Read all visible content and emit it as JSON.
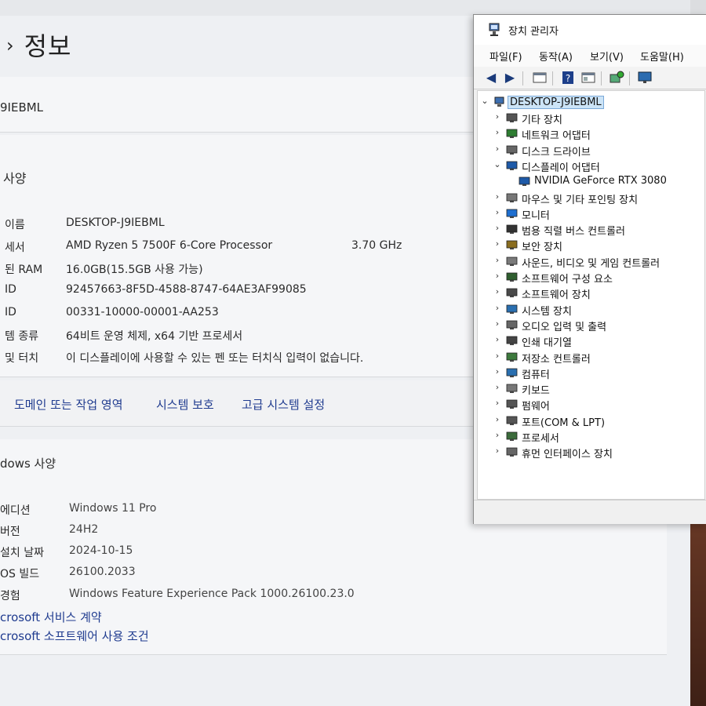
{
  "settings": {
    "breadcrumb_chevron": "›",
    "title": "정보",
    "device_name_partial": "9IEBML",
    "spec_header": "사양",
    "specs": [
      {
        "label": "이름",
        "value": "DESKTOP-J9IEBML",
        "extra": ""
      },
      {
        "label": "세서",
        "value": "AMD Ryzen 5 7500F 6-Core Processor",
        "extra": "3.70 GHz"
      },
      {
        "label": "된 RAM",
        "value": "16.0GB(15.5GB 사용 가능)",
        "extra": ""
      },
      {
        "label": "ID",
        "value": "92457663-8F5D-4588-8747-64AE3AF99085",
        "extra": ""
      },
      {
        "label": "ID",
        "value": "00331-10000-00001-AA253",
        "extra": ""
      },
      {
        "label": "템 종류",
        "value": "64비트 운영 체제, x64 기반 프로세서",
        "extra": ""
      },
      {
        "label": "및 터치",
        "value": "이 디스플레이에 사용할 수 있는 펜 또는 터치식 입력이 없습니다.",
        "extra": ""
      }
    ],
    "links": [
      "도메인 또는 작업 영역",
      "시스템 보호",
      "고급 시스템 설정"
    ],
    "windows_header": "dows 사양",
    "windows_specs": [
      {
        "label": "에디션",
        "value": "Windows 11 Pro"
      },
      {
        "label": "버전",
        "value": "24H2"
      },
      {
        "label": "설치 날짜",
        "value": "2024-10-15"
      },
      {
        "label": "OS 빌드",
        "value": "26100.2033"
      },
      {
        "label": "경험",
        "value": "Windows Feature Experience Pack 1000.26100.23.0"
      }
    ],
    "ms_links": [
      "crosoft 서비스 계약",
      "crosoft 소프트웨어 사용 조건"
    ]
  },
  "device_manager": {
    "title": "장치 관리자",
    "menu": [
      "파일(F)",
      "동작(A)",
      "보기(V)",
      "도움말(H)"
    ],
    "root": "DESKTOP-J9IEBML",
    "tree": [
      {
        "label": "기타 장치",
        "icon": "question-device-icon",
        "expanded": false,
        "level": 1
      },
      {
        "label": "네트워크 어댑터",
        "icon": "network-adapter-icon",
        "expanded": false,
        "level": 1
      },
      {
        "label": "디스크 드라이브",
        "icon": "disk-drive-icon",
        "expanded": false,
        "level": 1
      },
      {
        "label": "디스플레이 어댑터",
        "icon": "display-adapter-icon",
        "expanded": true,
        "level": 1
      },
      {
        "label": "NVIDIA GeForce RTX 3080",
        "icon": "gpu-icon",
        "expanded": null,
        "level": 2
      },
      {
        "label": "마우스 및 기타 포인팅 장치",
        "icon": "mouse-icon",
        "expanded": false,
        "level": 1
      },
      {
        "label": "모니터",
        "icon": "monitor-icon",
        "expanded": false,
        "level": 1
      },
      {
        "label": "범용 직렬 버스 컨트롤러",
        "icon": "usb-icon",
        "expanded": false,
        "level": 1
      },
      {
        "label": "보안 장치",
        "icon": "security-icon",
        "expanded": false,
        "level": 1
      },
      {
        "label": "사운드, 비디오 및 게임 컨트롤러",
        "icon": "sound-icon",
        "expanded": false,
        "level": 1
      },
      {
        "label": "소프트웨어 구성 요소",
        "icon": "software-component-icon",
        "expanded": false,
        "level": 1
      },
      {
        "label": "소프트웨어 장치",
        "icon": "software-device-icon",
        "expanded": false,
        "level": 1
      },
      {
        "label": "시스템 장치",
        "icon": "system-device-icon",
        "expanded": false,
        "level": 1
      },
      {
        "label": "오디오 입력 및 출력",
        "icon": "audio-icon",
        "expanded": false,
        "level": 1
      },
      {
        "label": "인쇄 대기열",
        "icon": "printer-icon",
        "expanded": false,
        "level": 1
      },
      {
        "label": "저장소 컨트롤러",
        "icon": "storage-controller-icon",
        "expanded": false,
        "level": 1
      },
      {
        "label": "컴퓨터",
        "icon": "computer-icon",
        "expanded": false,
        "level": 1
      },
      {
        "label": "키보드",
        "icon": "keyboard-icon",
        "expanded": false,
        "level": 1
      },
      {
        "label": "펌웨어",
        "icon": "firmware-icon",
        "expanded": false,
        "level": 1
      },
      {
        "label": "포트(COM & LPT)",
        "icon": "port-icon",
        "expanded": false,
        "level": 1
      },
      {
        "label": "프로세서",
        "icon": "processor-icon",
        "expanded": false,
        "level": 1
      },
      {
        "label": "휴먼 인터페이스 장치",
        "icon": "hid-icon",
        "expanded": false,
        "level": 1
      }
    ]
  },
  "colors": {
    "link": "#1f3b8f",
    "selection": "#cce4f7",
    "toolbar_icon": "#1a3a7a"
  }
}
